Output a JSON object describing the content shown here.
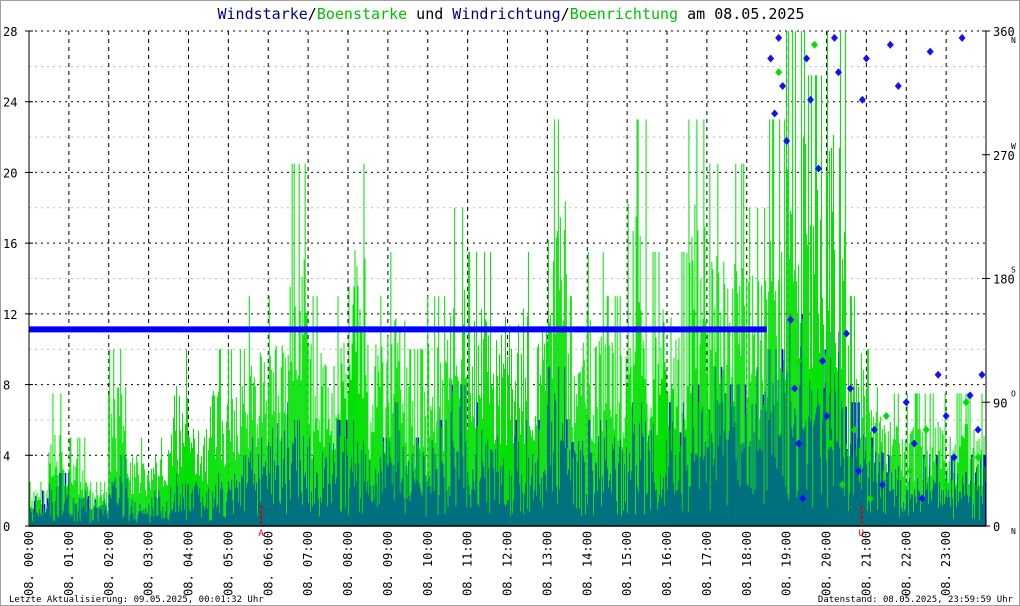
{
  "title": {
    "part1": "Windstarke",
    "sep1": "/",
    "part2": "Boenstarke",
    "mid": " und ",
    "part3": "Windrichtung",
    "sep2": "/",
    "part4": "Boenrichtung",
    "end": " am 08.05.2025"
  },
  "footer": {
    "left": "Letzte Aktualisierung: 09.05.2025, 00:01:32 Uhr",
    "right": "Datenstand: 08.05.2025, 23:59:59 Uhr"
  },
  "chart_data": {
    "type": "bar",
    "title": "Windstarke/Boenstarke und Windrichtung/Boenrichtung am 08.05.2025",
    "x_unit": "hour",
    "x_range": [
      0,
      24
    ],
    "x_tick_labels": [
      "08. 00:00",
      "08. 01:00",
      "08. 02:00",
      "08. 03:00",
      "08. 04:00",
      "08. 05:00",
      "08. 06:00",
      "08. 07:00",
      "08. 08:00",
      "08. 09:00",
      "08. 10:00",
      "08. 11:00",
      "08. 12:00",
      "08. 13:00",
      "08. 14:00",
      "08. 15:00",
      "08. 16:00",
      "08. 17:00",
      "08. 18:00",
      "08. 19:00",
      "08. 20:00",
      "08. 21:00",
      "08. 22:00",
      "08. 23:00"
    ],
    "y_left": {
      "range": [
        0,
        28
      ],
      "ticks": [
        "0",
        "4",
        "8",
        "12",
        "16",
        "20",
        "24",
        "28"
      ]
    },
    "y_right": {
      "range": [
        0,
        360
      ],
      "ticks": [
        "0",
        "90",
        "180",
        "270",
        "360"
      ],
      "compass": [
        "N",
        "O",
        "S",
        "W",
        "N"
      ]
    },
    "grid": true,
    "markers": [
      {
        "label": "A",
        "hour": 5.82
      },
      {
        "label": "U",
        "hour": 20.87
      }
    ],
    "half_hour_x": [
      0,
      0.5,
      1,
      1.5,
      2,
      2.5,
      3,
      3.5,
      4,
      4.5,
      5,
      5.5,
      6,
      6.5,
      7,
      7.5,
      8,
      8.5,
      9,
      9.5,
      10,
      10.5,
      11,
      11.5,
      12,
      12.5,
      13,
      13.5,
      14,
      14.5,
      15,
      15.5,
      16,
      16.5,
      17,
      17.5,
      18,
      18.5,
      19,
      19.5,
      20,
      20.5,
      21,
      21.5,
      22,
      22.5,
      23,
      23.5
    ],
    "series": [
      {
        "name": "Boenstarke",
        "color": "#00e000",
        "values": [
          2.5,
          7.5,
          5,
          2.5,
          10,
          5,
          5,
          10,
          7.5,
          10,
          10,
          13,
          13,
          20.5,
          13,
          13,
          20.5,
          13,
          15.5,
          10,
          13,
          18,
          15.5,
          15.5,
          15.5,
          15.5,
          23,
          13,
          15.5,
          13,
          23,
          15.5,
          15.5,
          23,
          20.5,
          20.5,
          18,
          23,
          28,
          25.5,
          28,
          13,
          10,
          7.5,
          7.5,
          7.5,
          7.5,
          7.5
        ]
      },
      {
        "name": "Windstarke",
        "color": "#0000ff",
        "values": [
          2,
          3,
          2,
          1.5,
          4,
          2,
          2,
          3,
          3,
          3,
          4,
          5,
          7,
          6,
          5,
          6,
          6,
          5,
          7,
          5,
          6,
          8,
          7,
          6,
          6,
          6,
          9,
          6,
          6,
          6,
          7,
          7,
          7,
          8,
          9,
          8,
          9,
          10,
          12,
          10,
          11,
          7,
          5,
          4,
          4,
          4,
          4,
          4
        ]
      }
    ],
    "direction": {
      "constant_until_hour": 18.5,
      "constant_deg": 143,
      "wind_points": [
        [
          18.6,
          340
        ],
        [
          18.7,
          300
        ],
        [
          18.8,
          355
        ],
        [
          18.9,
          320
        ],
        [
          19.0,
          280
        ],
        [
          19.1,
          150
        ],
        [
          19.2,
          100
        ],
        [
          19.3,
          60
        ],
        [
          19.4,
          20
        ],
        [
          19.5,
          340
        ],
        [
          19.6,
          310
        ],
        [
          19.8,
          260
        ],
        [
          19.9,
          120
        ],
        [
          20.0,
          80
        ],
        [
          20.2,
          355
        ],
        [
          20.3,
          330
        ],
        [
          20.5,
          140
        ],
        [
          20.6,
          100
        ],
        [
          20.8,
          40
        ],
        [
          20.9,
          310
        ],
        [
          21.0,
          340
        ],
        [
          21.2,
          70
        ],
        [
          21.4,
          30
        ],
        [
          21.6,
          350
        ],
        [
          21.8,
          320
        ],
        [
          22.0,
          90
        ],
        [
          22.2,
          60
        ],
        [
          22.4,
          20
        ],
        [
          22.6,
          345
        ],
        [
          22.8,
          110
        ],
        [
          23.0,
          80
        ],
        [
          23.2,
          50
        ],
        [
          23.4,
          355
        ],
        [
          23.6,
          95
        ],
        [
          23.8,
          70
        ],
        [
          23.9,
          110
        ]
      ],
      "gust_points": [
        [
          18.8,
          330
        ],
        [
          19.3,
          120
        ],
        [
          19.7,
          350
        ],
        [
          20.1,
          60
        ],
        [
          20.4,
          30
        ],
        [
          20.7,
          70
        ],
        [
          21.1,
          20
        ],
        [
          21.5,
          80
        ],
        [
          22.1,
          40
        ],
        [
          22.5,
          70
        ],
        [
          23.0,
          30
        ],
        [
          23.5,
          90
        ],
        [
          23.8,
          50
        ]
      ]
    }
  }
}
